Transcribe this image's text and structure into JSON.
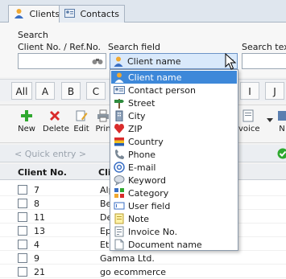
{
  "tabs": [
    {
      "label": "Clients",
      "icon": "person-icon",
      "active": true
    },
    {
      "label": "Contacts",
      "icon": "contacts-icon",
      "active": false
    }
  ],
  "search": {
    "title": "Search",
    "client_label": "Client No. / Ref.No.",
    "client_value": "",
    "field_label": "Search field",
    "field_value": "Client name",
    "text_label": "Search text",
    "text_value": ""
  },
  "alphabet": [
    "All",
    "A",
    "B",
    "C",
    "I",
    "J"
  ],
  "toolbar": [
    {
      "label": "New",
      "icon": "plus-icon"
    },
    {
      "label": "Delete",
      "icon": "delete-x-icon"
    },
    {
      "label": "Edit",
      "icon": "edit-icon"
    },
    {
      "label": "Prin",
      "icon": "printer-icon"
    },
    {
      "label": "voice",
      "icon": "invoice-icon"
    },
    {
      "label": "N",
      "icon": "new-icon"
    }
  ],
  "quick_entry": "< Quick entry >",
  "table": {
    "columns": [
      "Client No.",
      "Cli"
    ],
    "rows": [
      {
        "no": "7",
        "name": "Alp"
      },
      {
        "no": "8",
        "name": "Be"
      },
      {
        "no": "11",
        "name": "De"
      },
      {
        "no": "13",
        "name": "Ep"
      },
      {
        "no": "4",
        "name": "Eta"
      },
      {
        "no": "9",
        "name": "Gamma Ltd."
      },
      {
        "no": "21",
        "name": "go ecommerce"
      }
    ]
  },
  "dropdown": {
    "options": [
      {
        "label": "Client name",
        "icon": "person-icon",
        "selected": true
      },
      {
        "label": "Contact person",
        "icon": "contact-card-icon"
      },
      {
        "label": "Street",
        "icon": "signpost-icon"
      },
      {
        "label": "City",
        "icon": "building-icon"
      },
      {
        "label": "ZIP",
        "icon": "zip-icon"
      },
      {
        "label": "Country",
        "icon": "flag-icon"
      },
      {
        "label": "Phone",
        "icon": "phone-icon"
      },
      {
        "label": "E-mail",
        "icon": "at-icon"
      },
      {
        "label": "Keyword",
        "icon": "keyword-icon"
      },
      {
        "label": "Category",
        "icon": "category-icon"
      },
      {
        "label": "User field",
        "icon": "user-field-icon"
      },
      {
        "label": "Note",
        "icon": "note-icon"
      },
      {
        "label": "Invoice No.",
        "icon": "invoice-icon"
      },
      {
        "label": "Document name",
        "icon": "document-icon"
      }
    ]
  },
  "colors": {
    "selection": "#3d88d9",
    "combo_bg": "#d9e9fb",
    "ok": "#2fa82f"
  }
}
